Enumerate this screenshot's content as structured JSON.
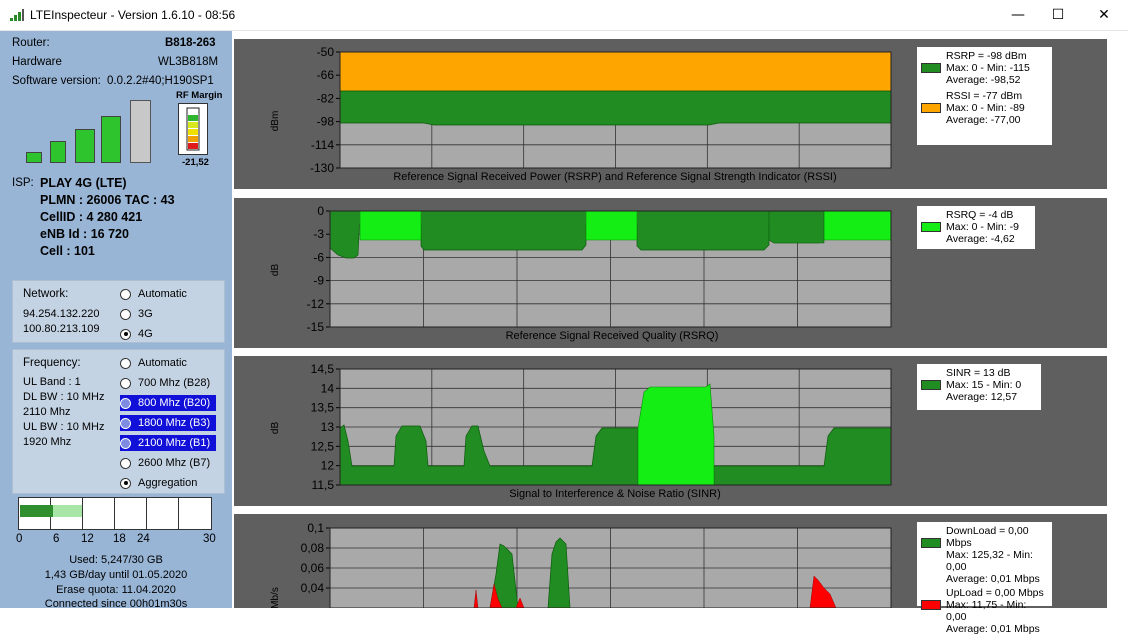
{
  "window": {
    "title": "LTEInspecteur - Version 1.6.10 - 08:56",
    "minimize": "—",
    "maximize": "☐",
    "close": "✕"
  },
  "device": {
    "router_label": "Router:",
    "router_value": "B818-263",
    "hardware_label": "Hardware",
    "hardware_value": "WL3B818M",
    "software_label": "Software version:",
    "software_value": "0.0.2.2#40;H190SP1"
  },
  "signal_bars": {
    "level": 4,
    "max": 5
  },
  "rf_margin": {
    "title": "RF Margin",
    "value": "-21,52"
  },
  "isp": {
    "label": "ISP:",
    "name": "PLAY 4G (LTE)",
    "plmn": "PLMN : 26006 TAC : 43",
    "cellid": "CellID : 4 280 421",
    "enb": "eNB Id : 16 720",
    "cell": "Cell : 101"
  },
  "network": {
    "label": "Network:",
    "ip1": "94.254.132.220",
    "ip2": "100.80.213.109",
    "options": [
      {
        "label": "Automatic",
        "selected": false
      },
      {
        "label": "3G",
        "selected": false
      },
      {
        "label": "4G",
        "selected": true
      }
    ]
  },
  "frequency": {
    "label": "Frequency:",
    "ul_band": "UL Band : 1",
    "dl_bw": "DL BW : 10 MHz",
    "dl_freq": "2110 Mhz",
    "ul_bw": "UL BW : 10 MHz",
    "ul_freq": "1920 Mhz",
    "options": [
      {
        "label": "Automatic",
        "selected": false,
        "highlight": false
      },
      {
        "label": "700 Mhz (B28)",
        "selected": false,
        "highlight": false
      },
      {
        "label": "800 Mhz (B20)",
        "selected": false,
        "highlight": true
      },
      {
        "label": "1800 Mhz (B3)",
        "selected": false,
        "highlight": true
      },
      {
        "label": "2100 Mhz (B1)",
        "selected": false,
        "highlight": true
      },
      {
        "label": "2600 Mhz (B7)",
        "selected": false,
        "highlight": false
      },
      {
        "label": "Aggregation",
        "selected": true,
        "highlight": false
      }
    ]
  },
  "usage": {
    "scale": [
      "0",
      "6",
      "12",
      "18",
      "24",
      "30"
    ],
    "used_gb": 5.247,
    "max_gb": 30,
    "used": "Used: 5,247/30 GB",
    "per_day": "1,43 GB/day until 01.05.2020",
    "erase": "Erase quota: 11.04.2020",
    "connected": "Connected since 00h01m30s"
  },
  "colors": {
    "panel_bg": "#5f5f5f",
    "plot_bg": "#a9a9a9",
    "dark_green": "#218c21",
    "light_green": "#14ee14",
    "orange": "#ffa500",
    "red": "#ff0000",
    "left_bg": "#98b5d6"
  },
  "chart_data": [
    {
      "type": "area",
      "title": "Reference Signal Received Power (RSRP) and Reference Signal Strength Indicator (RSSI)",
      "ylabel": "dBm",
      "ylim": [
        -130,
        -50
      ],
      "yticks": [
        "-50",
        "-66",
        "-82",
        "-98",
        "-114",
        "-130"
      ],
      "series": [
        {
          "name": "RSSI",
          "values": [
            -50,
            -50,
            -50,
            -50,
            -50
          ]
        },
        {
          "name": "RSRP",
          "values": [
            -98,
            -98,
            -99,
            -98,
            -98
          ]
        }
      ],
      "legend": [
        {
          "color": "#218c21",
          "lines": [
            "RSRP = -98 dBm",
            "Max: 0 - Min: -115",
            "Average: -98,52"
          ]
        },
        {
          "color": "#ffa500",
          "lines": [
            "RSSI = -77 dBm",
            "Max: 0 - Min: -89",
            "Average: -77,00"
          ]
        }
      ]
    },
    {
      "type": "area",
      "title": "Reference Signal Received Quality (RSRQ)",
      "ylabel": "dB",
      "ylim": [
        -15,
        0
      ],
      "yticks": [
        "0",
        "-3",
        "-6",
        "-9",
        "-12",
        "-15"
      ],
      "segments": [
        {
          "from": 0.0,
          "to": 0.05,
          "top": -5.5,
          "color": "dark"
        },
        {
          "from": 0.05,
          "to": 0.14,
          "top": -1,
          "color": "light"
        },
        {
          "from": 0.14,
          "to": 0.46,
          "top": -5,
          "color": "dark"
        },
        {
          "from": 0.46,
          "to": 0.57,
          "top": -1,
          "color": "light"
        },
        {
          "from": 0.57,
          "to": 0.75,
          "top": -5,
          "color": "dark"
        },
        {
          "from": 0.75,
          "to": 0.82,
          "top": -1,
          "color": "light"
        },
        {
          "from": 0.82,
          "to": 1.0,
          "top": -1,
          "color": "light"
        }
      ],
      "legend": [
        {
          "color": "#14ee14",
          "lines": [
            "RSRQ = -4 dB",
            "Max: 0 - Min: -9",
            "Average: -4,62"
          ]
        }
      ]
    },
    {
      "type": "area",
      "title": "Signal to Interference & Noise Ratio (SINR)",
      "ylabel": "dB",
      "ylim": [
        11.5,
        14.5
      ],
      "yticks": [
        "14,5",
        "14",
        "13,5",
        "13",
        "12,5",
        "12",
        "11,5"
      ],
      "legend": [
        {
          "color": "#218c21",
          "lines": [
            "SINR = 13 dB",
            "Max: 15 - Min: 0",
            "Average: 12,57"
          ]
        }
      ]
    },
    {
      "type": "area",
      "title": "",
      "ylabel": "Mb/s",
      "ylim": [
        0,
        0.1
      ],
      "yticks": [
        "0,1",
        "0,08",
        "0,06",
        "0,04"
      ],
      "legend": [
        {
          "color": "#218c21",
          "lines": [
            "DownLoad = 0,00 Mbps",
            "Max: 125,32 - Min: 0,00",
            "Average: 0,01 Mbps"
          ]
        },
        {
          "color": "#ff0000",
          "lines": [
            "UpLoad = 0,00 Mbps",
            "Max: 11,75 - Min: 0,00",
            "Average: 0,01 Mbps"
          ]
        }
      ]
    }
  ]
}
